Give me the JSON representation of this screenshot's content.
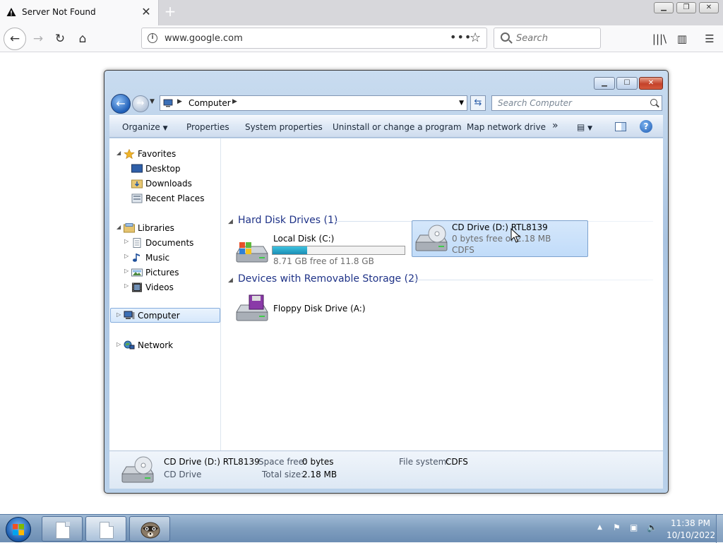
{
  "browser": {
    "tab_title": "Server Not Found",
    "close_tab": "✕",
    "new_tab": "+",
    "url": "www.google.com",
    "page_actions": "•••",
    "search_placeholder": "Search"
  },
  "explorer": {
    "address": {
      "crumb": "Computer"
    },
    "search_placeholder": "Search Computer",
    "commands": {
      "organize": "Organize",
      "properties": "Properties",
      "system_properties": "System properties",
      "uninstall": "Uninstall or change a program",
      "map_drive": "Map network drive",
      "more": "»"
    },
    "nav": {
      "favorites": "Favorites",
      "desktop": "Desktop",
      "downloads": "Downloads",
      "recent": "Recent Places",
      "libraries": "Libraries",
      "documents": "Documents",
      "music": "Music",
      "pictures": "Pictures",
      "videos": "Videos",
      "computer": "Computer",
      "network": "Network"
    },
    "groups": {
      "hdd": "Hard Disk Drives (1)",
      "removable": "Devices with Removable Storage (2)"
    },
    "drives": {
      "c_name": "Local Disk (C:)",
      "c_space": "8.71 GB free of 11.8 GB",
      "c_used_fraction": 0.26,
      "a_name": "Floppy Disk Drive (A:)",
      "d_name": "CD Drive (D:) RTL8139",
      "d_space": "0 bytes free of 2.18 MB",
      "d_fs": "CDFS"
    },
    "details": {
      "name": "CD Drive (D:) RTL8139",
      "type": "CD Drive",
      "space_free_label": "Space free:",
      "space_free": "0 bytes",
      "total_label": "Total size:",
      "total": "2.18 MB",
      "fs_label": "File system:",
      "fs": "CDFS"
    }
  },
  "taskbar": {
    "time": "11:38 PM",
    "date": "10/10/2022"
  },
  "colors": {
    "accent": "#1e3287",
    "selection": "#c1dcf9",
    "capacity_fill": "#1a8eb5"
  }
}
